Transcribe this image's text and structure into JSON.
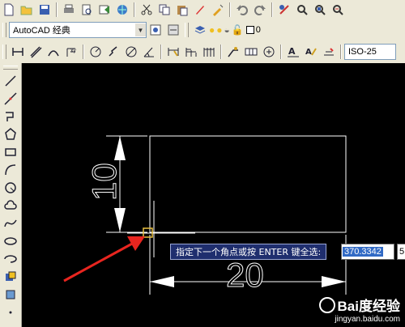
{
  "toolbar1": {
    "icons": [
      "new-file-icon",
      "open-file-icon",
      "save-icon",
      "print-icon",
      "print-preview-icon",
      "publish-icon",
      "plot-icon",
      "cut-icon",
      "copy-icon",
      "paste-icon",
      "match-properties-icon",
      "block-editor-icon",
      "undo-icon",
      "redo-icon",
      "pan-icon",
      "zoom-realtime-icon",
      "zoom-window-icon",
      "zoom-previous-icon"
    ]
  },
  "toolbar2": {
    "workspace_value": "AutoCAD 经典",
    "layer_value": "0"
  },
  "toolbar3": {
    "dimstyle_value": "ISO-25"
  },
  "canvas": {
    "dim_vertical": "10",
    "dim_horizontal": "20",
    "prompt_text": "指定下一个角点或按 ENTER 键全选:",
    "coord_x": "370.3342",
    "coord_y": "5"
  },
  "watermark": {
    "brand": "Bai度经验",
    "url": "jingyan.baidu.com"
  },
  "colors": {
    "canvas_bg": "#000000",
    "geometry": "#ffffff",
    "arrow": "#e8251f",
    "prompt_bg": "#1f2e6e",
    "selection": "#316ac5"
  }
}
